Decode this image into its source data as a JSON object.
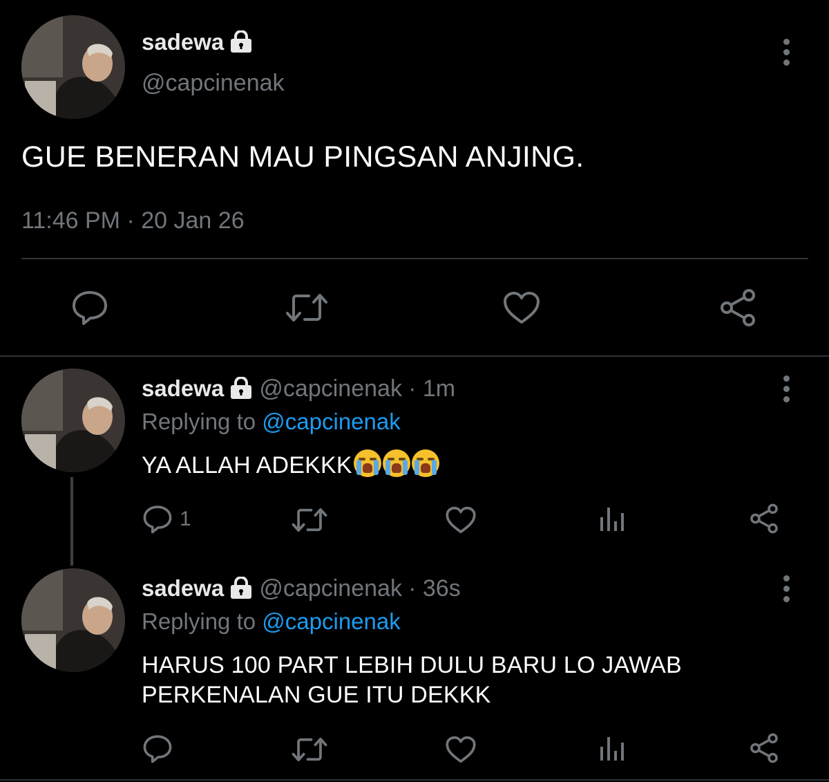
{
  "main_tweet": {
    "name": "sadewa",
    "handle": "@capcinenak",
    "text": "GUE BENERAN MAU PINGSAN ANJING.",
    "time": "11:46 PM",
    "separator": "·",
    "date": "20 Jan 26",
    "icons": [
      "reply-icon",
      "retweet-icon",
      "like-icon",
      "share-icon"
    ]
  },
  "replies": [
    {
      "name": "sadewa",
      "handle": "@capcinenak",
      "meta": "· 1m",
      "replying_label": "Replying to",
      "replying_handle": "@capcinenak",
      "text": "YA ALLAH ADEKKK",
      "emojis": [
        "loudly-crying-face",
        "loudly-crying-face",
        "loudly-crying-face"
      ],
      "reply_count": "1"
    },
    {
      "name": "sadewa",
      "handle": "@capcinenak",
      "meta": "· 36s",
      "replying_label": "Replying to",
      "replying_handle": "@capcinenak",
      "text_line1": "HARUS 100 PART LEBIH DULU BARU LO JAWAB",
      "text_line2": "PERKENALAN GUE ITU DEKKK",
      "reply_count": ""
    }
  ],
  "colors": {
    "background": "#000000",
    "text": "#e7e9ea",
    "muted": "#71767b",
    "link": "#1d9bf0",
    "divider": "#2f3336"
  }
}
